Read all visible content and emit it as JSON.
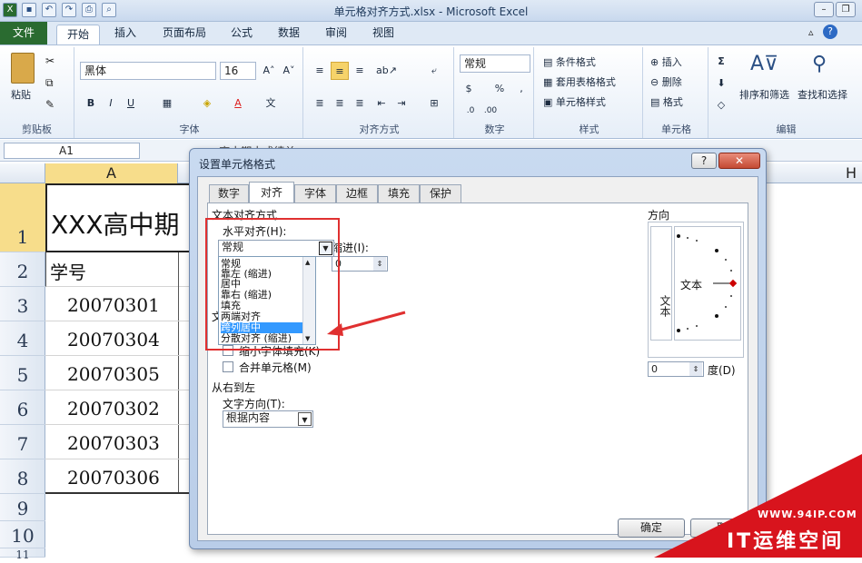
{
  "window": {
    "title": "单元格对齐方式.xlsx - Microsoft Excel"
  },
  "ribbon_tabs": {
    "file": "文件",
    "items": [
      "开始",
      "插入",
      "页面布局",
      "公式",
      "数据",
      "审阅",
      "视图"
    ]
  },
  "clipboard": {
    "paste": "粘贴",
    "label": "剪贴板"
  },
  "font": {
    "name": "黑体",
    "size": "16",
    "bold": "B",
    "italic": "I",
    "underline": "U",
    "label": "字体"
  },
  "alignment": {
    "label": "对齐方式"
  },
  "number": {
    "format": "常规",
    "percent": "%",
    "comma": ",",
    "label": "数字"
  },
  "styles": {
    "conditional": "条件格式",
    "table": "套用表格格式",
    "cell": "单元格样式",
    "label": "样式"
  },
  "cells": {
    "insert": "插入",
    "delete": "删除",
    "format": "格式",
    "label": "单元格"
  },
  "editing": {
    "sort": "排序和筛选",
    "find": "查找和选择",
    "label": "编辑",
    "sigma": "Σ"
  },
  "formula_bar": {
    "namebox": "A1",
    "fx": "xxx高中期中成绩单"
  },
  "sheet": {
    "col_a": "A",
    "col_h": "H",
    "rows": [
      "1",
      "2",
      "3",
      "4",
      "5",
      "6",
      "7",
      "8",
      "9",
      "10",
      "11"
    ],
    "title_cell": "XXX高中期",
    "header_cell": "学号",
    "data": [
      "20070301",
      "20070304",
      "20070305",
      "20070302",
      "20070303",
      "20070306"
    ]
  },
  "dialog": {
    "title": "设置单元格格式",
    "help": "?",
    "close": "✕",
    "tabs": [
      "数字",
      "对齐",
      "字体",
      "边框",
      "填充",
      "保护"
    ],
    "text_align_section": "文本对齐方式",
    "horizontal_label": "水平对齐(H):",
    "horizontal_value": "常规",
    "indent_label": "缩进(I):",
    "indent_value": "0",
    "horizontal_options": [
      "常规",
      "靠左 (缩进)",
      "居中",
      "靠右 (缩进)",
      "填充",
      "两端对齐",
      "跨列居中",
      "分散对齐 (缩进)"
    ],
    "selected_option": "跨列居中",
    "text_control_prefix": "文",
    "shrink_label": "缩小字体填充(K)",
    "merge_label": "合并单元格(M)",
    "rtl_section": "从右到左",
    "direction_label": "文字方向(T):",
    "direction_value": "根据内容",
    "orientation_section": "方向",
    "vertical_text": "文本",
    "orient_text": "文本",
    "degree_value": "0",
    "degree_label": "度(D)",
    "ok": "确定",
    "cancel": "取"
  },
  "watermark": {
    "url": "WWW.94IP.COM",
    "brand": "IT运维空间"
  },
  "colors": {
    "file_tab": "#2a6b30",
    "highlight": "#e03030",
    "selection": "#3399ff"
  }
}
